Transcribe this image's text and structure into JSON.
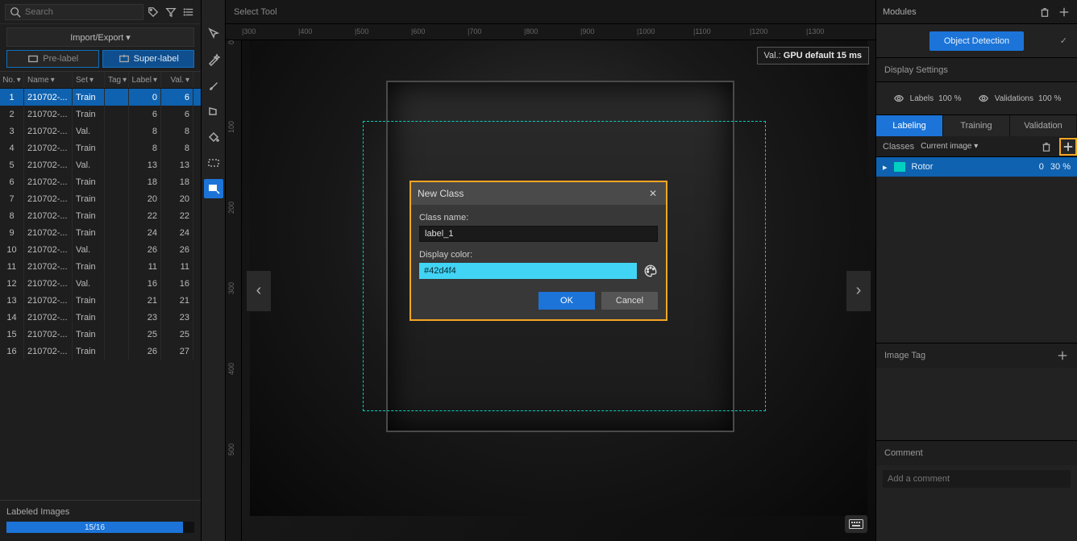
{
  "search": {
    "placeholder": "Search"
  },
  "import_export_label": "Import/Export ▾",
  "prelabel_label": "Pre-label",
  "superlabel_label": "Super-label",
  "table_headers": {
    "no": "No.",
    "name": "Name",
    "set": "Set",
    "tag": "Tag",
    "label": "Label",
    "val": "Val."
  },
  "rows": [
    {
      "no": "1",
      "name": "210702-...",
      "set": "Train",
      "label": "0",
      "val": "6"
    },
    {
      "no": "2",
      "name": "210702-...",
      "set": "Train",
      "label": "6",
      "val": "6"
    },
    {
      "no": "3",
      "name": "210702-...",
      "set": "Val.",
      "label": "8",
      "val": "8"
    },
    {
      "no": "4",
      "name": "210702-...",
      "set": "Train",
      "label": "8",
      "val": "8"
    },
    {
      "no": "5",
      "name": "210702-...",
      "set": "Val.",
      "label": "13",
      "val": "13"
    },
    {
      "no": "6",
      "name": "210702-...",
      "set": "Train",
      "label": "18",
      "val": "18"
    },
    {
      "no": "7",
      "name": "210702-...",
      "set": "Train",
      "label": "20",
      "val": "20"
    },
    {
      "no": "8",
      "name": "210702-...",
      "set": "Train",
      "label": "22",
      "val": "22"
    },
    {
      "no": "9",
      "name": "210702-...",
      "set": "Train",
      "label": "24",
      "val": "24"
    },
    {
      "no": "10",
      "name": "210702-...",
      "set": "Val.",
      "label": "26",
      "val": "26"
    },
    {
      "no": "11",
      "name": "210702-...",
      "set": "Train",
      "label": "11",
      "val": "11"
    },
    {
      "no": "12",
      "name": "210702-...",
      "set": "Val.",
      "label": "16",
      "val": "16"
    },
    {
      "no": "13",
      "name": "210702-...",
      "set": "Train",
      "label": "21",
      "val": "21"
    },
    {
      "no": "14",
      "name": "210702-...",
      "set": "Train",
      "label": "23",
      "val": "23"
    },
    {
      "no": "15",
      "name": "210702-...",
      "set": "Train",
      "label": "25",
      "val": "25"
    },
    {
      "no": "16",
      "name": "210702-...",
      "set": "Train",
      "label": "26",
      "val": "27"
    }
  ],
  "labeled_footer": {
    "title": "Labeled Images",
    "progress_text": "15/16"
  },
  "center": {
    "tool_label": "Select Tool",
    "val_prefix": "Val.:",
    "val_text": "GPU default 15 ms",
    "ruler_h": [
      "|300",
      "|400",
      "|500",
      "|600",
      "|700",
      "|800",
      "|900",
      "|1000",
      "|1100",
      "|1200",
      "|1300"
    ],
    "ruler_v": [
      "0",
      "100",
      "200",
      "300",
      "400",
      "500"
    ]
  },
  "right": {
    "modules_title": "Modules",
    "module_btn": "Object Detection",
    "display_settings_title": "Display Settings",
    "labels_label": "Labels",
    "labels_pct": "100 %",
    "validations_label": "Validations",
    "validations_pct": "100 %",
    "tabs": {
      "labeling": "Labeling",
      "training": "Training",
      "validation": "Validation"
    },
    "classes_label": "Classes",
    "scope_label": "Current image ▾",
    "class_item": {
      "name": "Rotor",
      "count": "0",
      "pct": "30 %"
    },
    "image_tag_title": "Image Tag",
    "comment_title": "Comment",
    "comment_placeholder": "Add a comment"
  },
  "dialog": {
    "title": "New Class",
    "class_name_label": "Class name:",
    "class_name_value": "label_1",
    "display_color_label": "Display color:",
    "color_value": "#42d4f4",
    "ok": "OK",
    "cancel": "Cancel"
  }
}
